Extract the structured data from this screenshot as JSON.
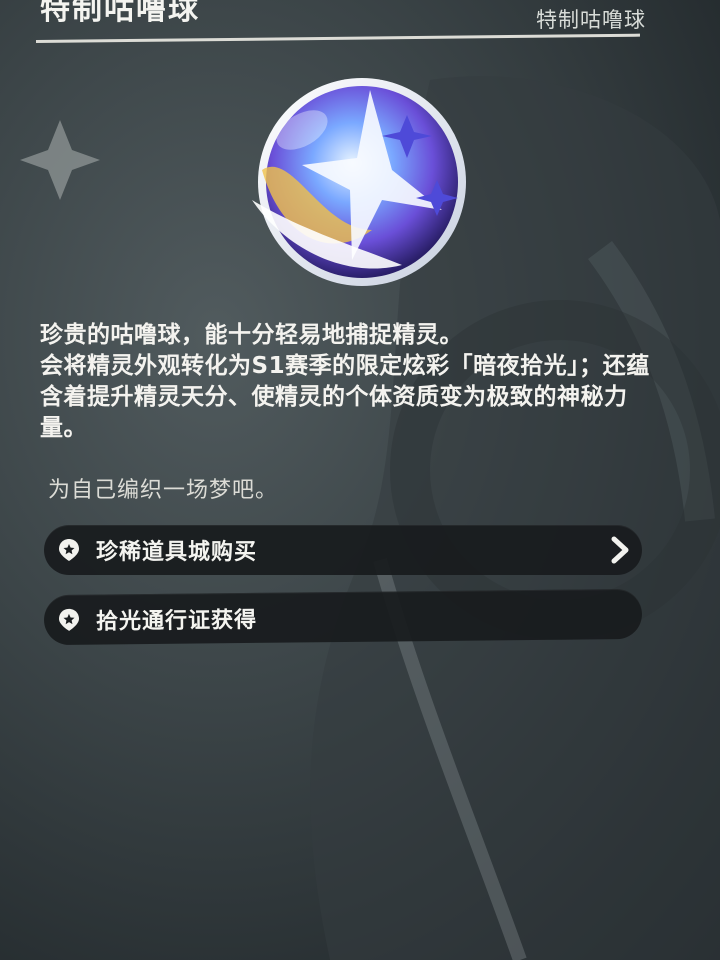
{
  "header": {
    "title": "特制咕噜球",
    "subtitle": "特制咕噜球"
  },
  "item": {
    "icon": "orb-icon",
    "description": [
      "珍贵的咕噜球，能十分轻易地捕捉精灵。",
      "会将精灵外观转化为S1赛季的限定炫彩「暗夜拾光」；还蕴含着提升精灵天分、使精灵的个体资质变为极致的神秘力量。"
    ],
    "flavor": "为自己编织一场梦吧。"
  },
  "sources": [
    {
      "label": "珍稀道具城购买",
      "icon": "location-pin-icon",
      "arrow": "chevron-right-icon"
    },
    {
      "label": "拾光通行证获得",
      "icon": "location-pin-icon"
    }
  ],
  "colors": {
    "background": "#3c4548",
    "button_bg": "#181b1d",
    "text": "#f4f3ef",
    "orb_purple": "#6a4fd8",
    "orb_gold": "#f0c24a"
  }
}
